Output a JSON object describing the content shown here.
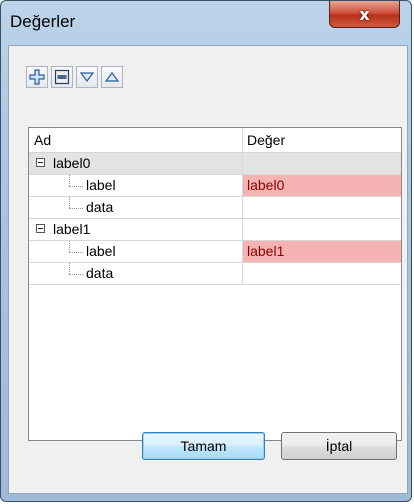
{
  "window": {
    "title": "Değerler",
    "close_glyph": "x"
  },
  "toolbar": {
    "buttons": [
      {
        "name": "add",
        "icon": "plus-icon"
      },
      {
        "name": "remove",
        "icon": "minus-icon"
      },
      {
        "name": "move-down",
        "icon": "triangle-down-icon"
      },
      {
        "name": "move-up",
        "icon": "triangle-up-icon"
      }
    ]
  },
  "grid": {
    "headers": {
      "name": "Ad",
      "value": "Değer"
    },
    "groups": [
      {
        "label": "label0",
        "children": [
          {
            "name": "label",
            "value": "label0",
            "highlight": true
          },
          {
            "name": "data",
            "value": "",
            "highlight": false
          }
        ]
      },
      {
        "label": "label1",
        "children": [
          {
            "name": "label",
            "value": "label1",
            "highlight": true
          },
          {
            "name": "data",
            "value": "",
            "highlight": false
          }
        ]
      }
    ]
  },
  "buttons": {
    "ok": "Tamam",
    "cancel": "İptal"
  },
  "colors": {
    "highlight": "#f6b3b3",
    "value_text": "#8b0000",
    "accent": "#3c7fb1"
  }
}
